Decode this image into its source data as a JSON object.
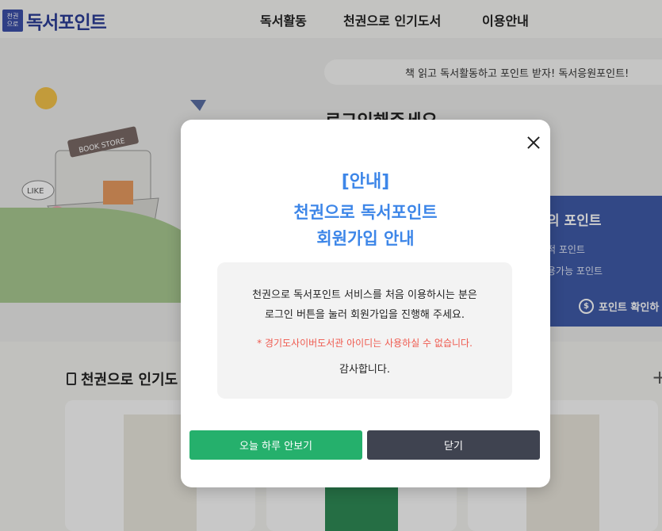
{
  "header": {
    "logo_mark_top": "천권",
    "logo_mark_bottom": "으로",
    "logo_text": "독서포인트",
    "nav": [
      "독서활동",
      "천권으로 인기도서",
      "이용안내"
    ]
  },
  "hero": {
    "banner_text": "책 읽고 독서활동하고 포인트 받자! 독서응원포인트!",
    "login_prompt": "로그인해주세요",
    "illustration_sign": "BOOK STORE",
    "illustration_like": "LIKE"
  },
  "point_card": {
    "title": "의 포인트",
    "row1": "적 포인트",
    "row2": "용가능 포인트",
    "check_button": "포인트 확인하"
  },
  "section": {
    "title": "천권으로 인기도"
  },
  "modal": {
    "notice": "[안내]",
    "title_line1": "천권으로 독서포인트",
    "title_line2": "회원가입 안내",
    "body_line1": "천권으로 독서포인트 서비스를 처음 이용하시는 분은",
    "body_line2": "로그인 버튼을 눌러 회원가입을 진행해 주세요.",
    "warning": "* 경기도사이버도서관 아이디는 사용하실 수 없습니다.",
    "thanks": "감사합니다.",
    "btn_hide_today": "오늘 하루 안보기",
    "btn_close": "닫기"
  },
  "colors": {
    "accent_blue": "#3d86e8",
    "warning_red": "#ef5a4f",
    "green_button": "#25b06c",
    "dark_button": "#3f4350",
    "point_card": "#3f5aa8"
  }
}
